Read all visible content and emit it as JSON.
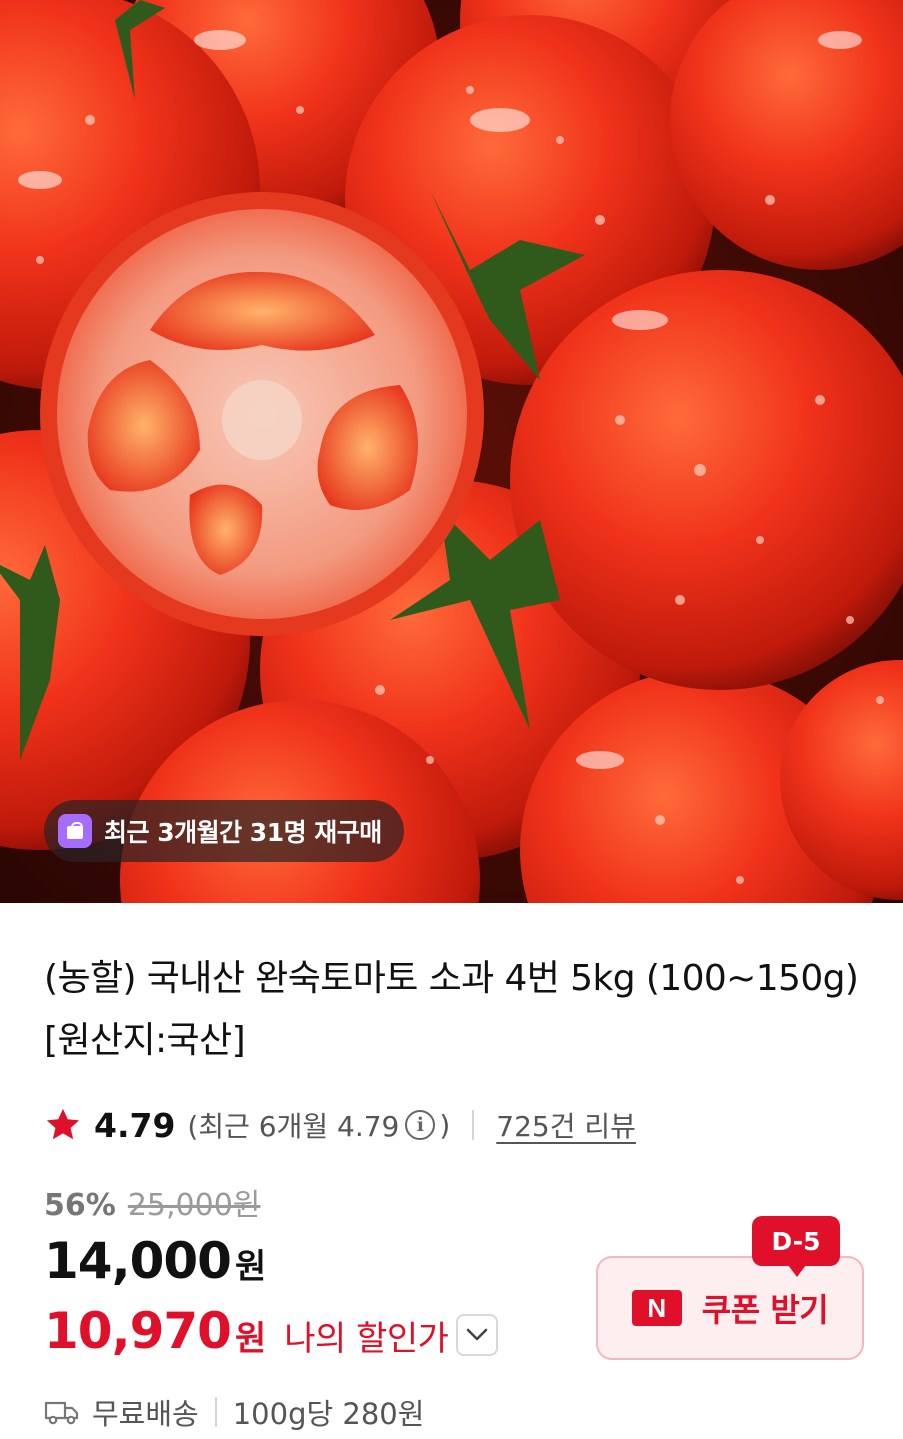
{
  "hero": {
    "repurchase_badge": {
      "text": "최근 3개월간 31명 재구매",
      "icon": "shopping-bag-icon"
    }
  },
  "product": {
    "title": "(농할) 국내산 완숙토마토 소과 4번 5kg (100~150g) [원산지:국산]",
    "rating": {
      "value": "4.79",
      "detail_prefix": "(최근 6개월 4.79",
      "detail_suffix": ")",
      "info_icon": "i",
      "review_link": "725건 리뷰"
    },
    "price": {
      "discount_rate": "56%",
      "original_price": "25,000원",
      "sale_price": "14,000",
      "sale_currency": "원",
      "my_price": "10,970",
      "my_price_currency": "원",
      "my_price_label": "나의 할인가"
    },
    "coupon": {
      "dday": "D-5",
      "brand_icon_text": "N",
      "label": "쿠폰 받기"
    },
    "shipping": {
      "label": "무료배송",
      "unit_price": "100g당 280원"
    }
  },
  "colors": {
    "accent_red": "#e0102a",
    "coupon_bg": "#fdeef0",
    "badge_purple": "#a66bff"
  }
}
